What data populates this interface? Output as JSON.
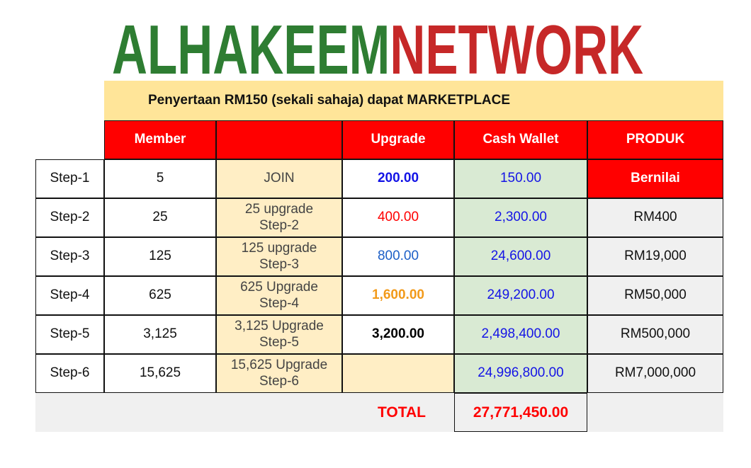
{
  "logo": {
    "part1": "ALHAKEEM",
    "part2": "NETWORK",
    "color1": "#2e7d32",
    "color2": "#c62828"
  },
  "banner": "Penyertaan RM150 (sekali sahaja) dapat MARKETPLACE",
  "headers": {
    "member": "Member",
    "blank": "",
    "upgrade": "Upgrade",
    "cash_wallet": "Cash Wallet",
    "produk": "PRODUK"
  },
  "rows": [
    {
      "step": "Step-1",
      "member": "5",
      "desc1": "JOIN",
      "desc2": "",
      "upgrade": "200.00",
      "cash": "150.00",
      "produk": "Bernilai"
    },
    {
      "step": "Step-2",
      "member": "25",
      "desc1": "25 upgrade",
      "desc2": "Step-2",
      "upgrade": "400.00",
      "cash": "2,300.00",
      "produk": "RM400"
    },
    {
      "step": "Step-3",
      "member": "125",
      "desc1": "125 upgrade",
      "desc2": "Step-3",
      "upgrade": "800.00",
      "cash": "24,600.00",
      "produk": "RM19,000"
    },
    {
      "step": "Step-4",
      "member": "625",
      "desc1": "625 Upgrade",
      "desc2": "Step-4",
      "upgrade": "1,600.00",
      "cash": "249,200.00",
      "produk": "RM50,000"
    },
    {
      "step": "Step-5",
      "member": "3,125",
      "desc1": "3,125 Upgrade",
      "desc2": "Step-5",
      "upgrade": "3,200.00",
      "cash": "2,498,400.00",
      "produk": "RM500,000"
    },
    {
      "step": "Step-6",
      "member": "15,625",
      "desc1": "15,625 Upgrade",
      "desc2": "Step-6",
      "upgrade": "",
      "cash": "24,996,800.00",
      "produk": "RM7,000,000"
    }
  ],
  "total": {
    "label": "TOTAL",
    "value": "27,771,450.00"
  }
}
